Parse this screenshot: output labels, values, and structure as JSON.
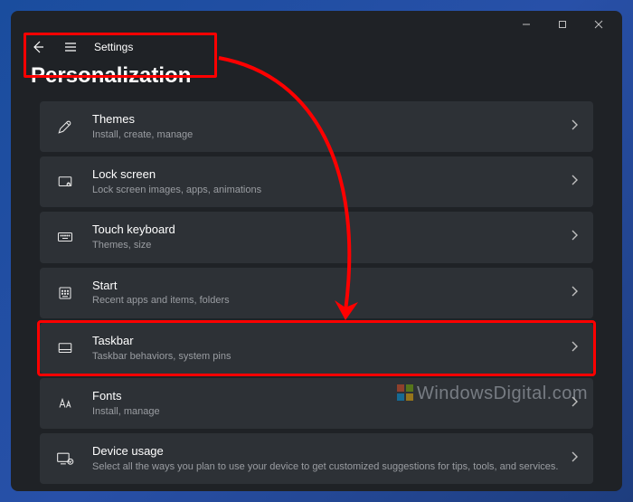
{
  "app_title": "Settings",
  "page_title": "Personalization",
  "watermark": "WindowsDigital.com",
  "items": [
    {
      "title": "Themes",
      "subtitle": "Install, create, manage"
    },
    {
      "title": "Lock screen",
      "subtitle": "Lock screen images, apps, animations"
    },
    {
      "title": "Touch keyboard",
      "subtitle": "Themes, size"
    },
    {
      "title": "Start",
      "subtitle": "Recent apps and items, folders"
    },
    {
      "title": "Taskbar",
      "subtitle": "Taskbar behaviors, system pins"
    },
    {
      "title": "Fonts",
      "subtitle": "Install, manage"
    },
    {
      "title": "Device usage",
      "subtitle": "Select all the ways you plan to use your device to get customized suggestions for tips, tools, and services."
    }
  ]
}
